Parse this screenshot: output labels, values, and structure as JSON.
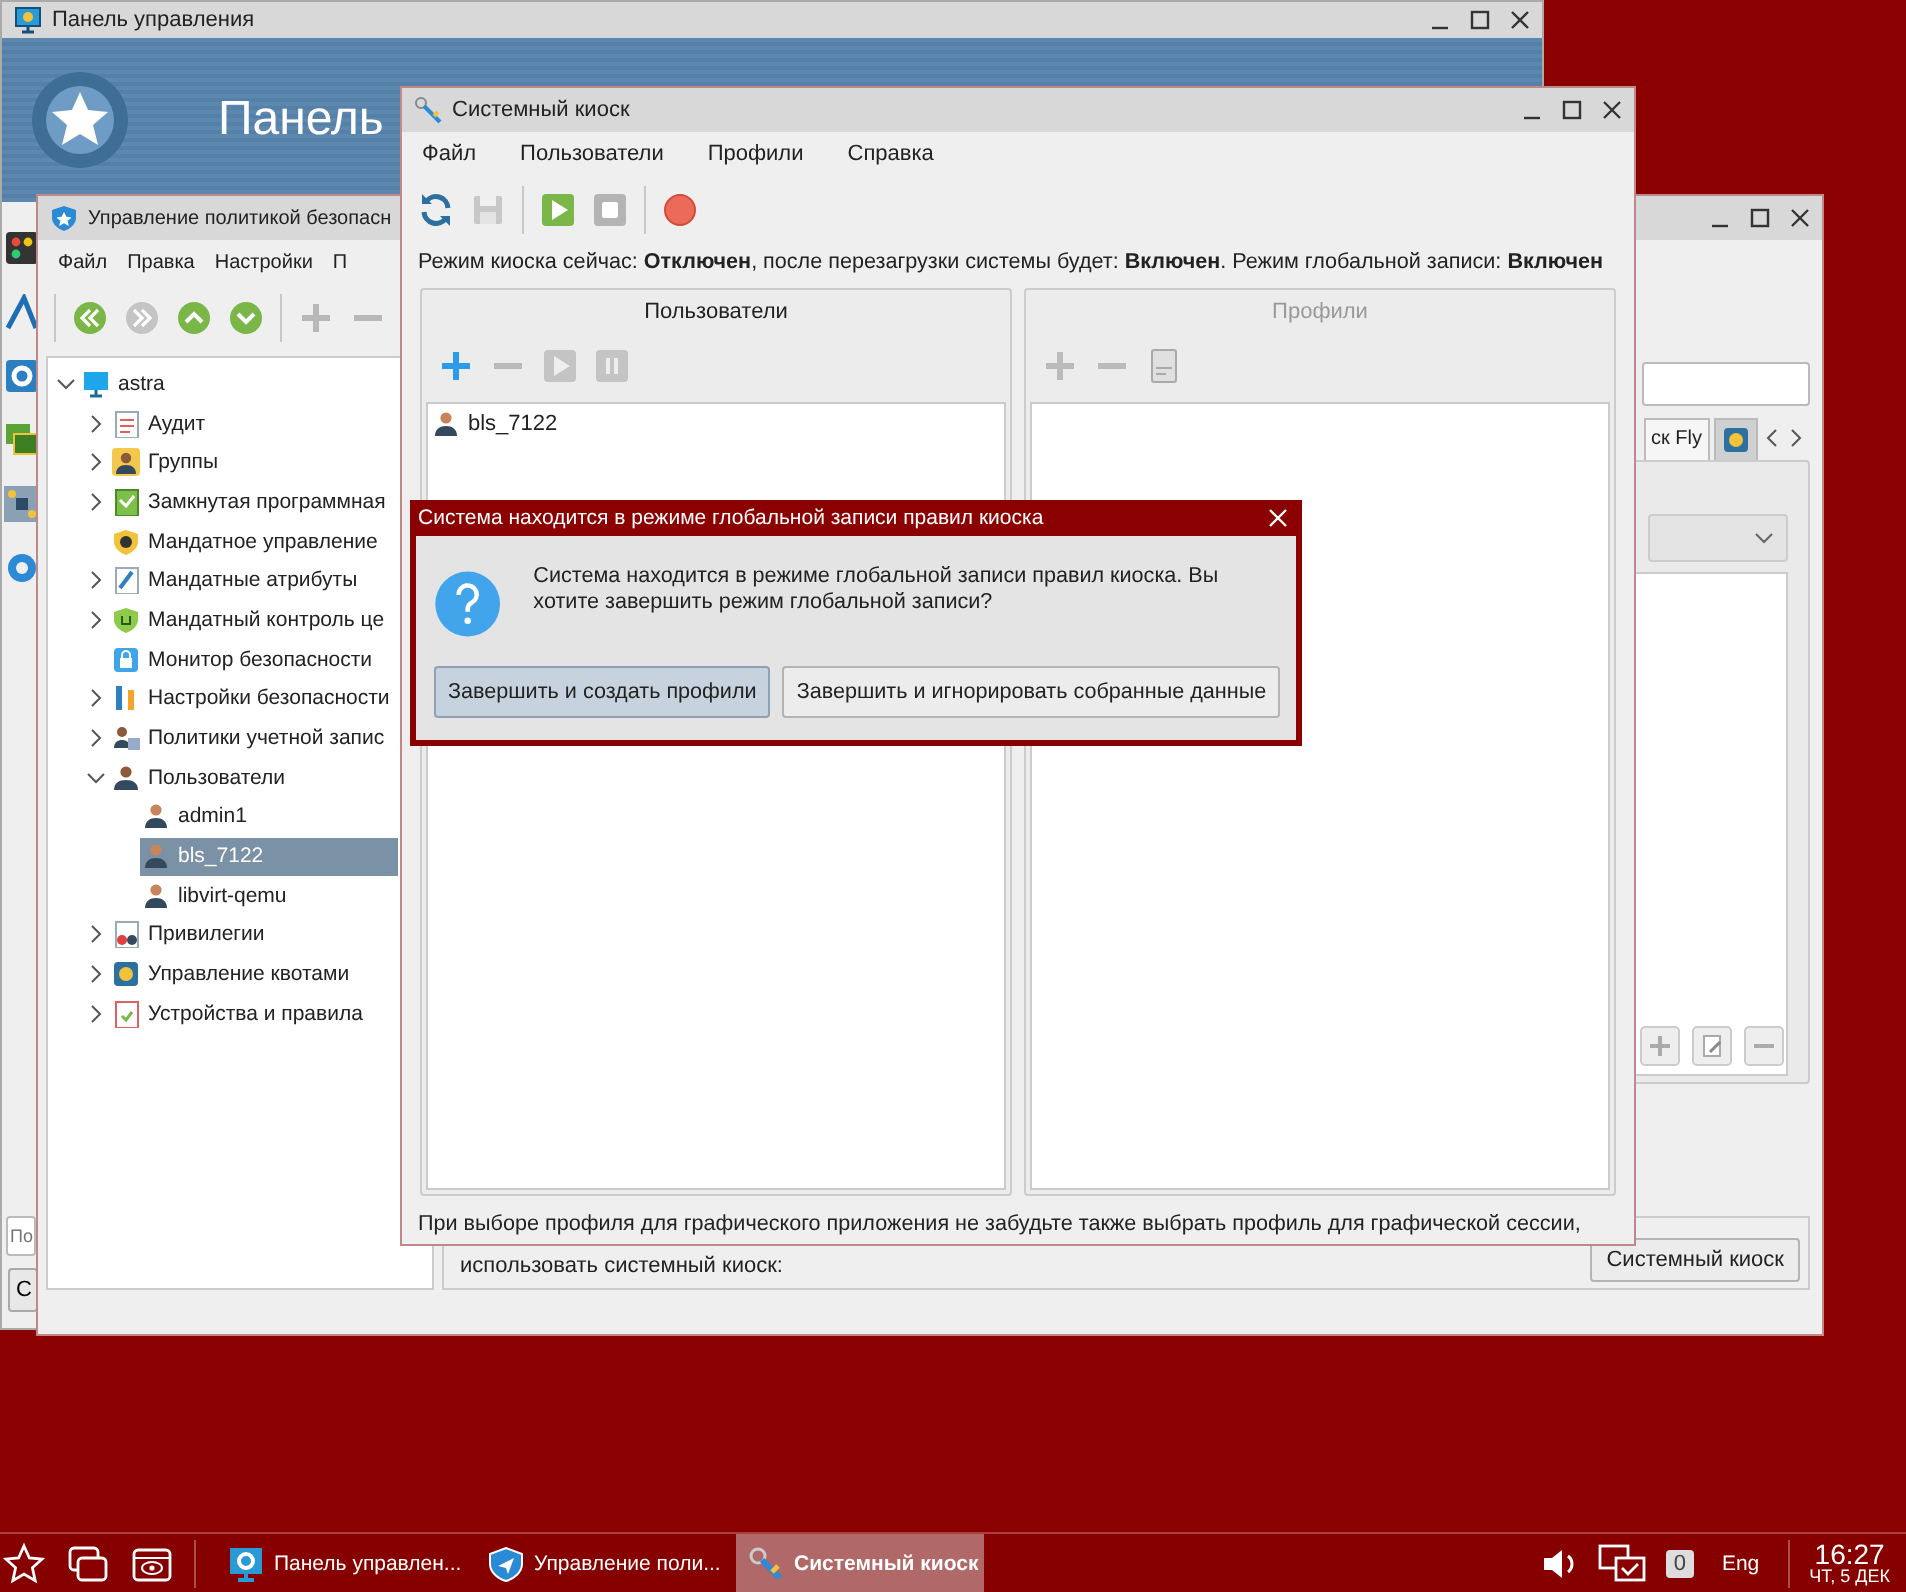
{
  "control_panel": {
    "title": "Панель управления",
    "banner_title": "Панель",
    "search": {
      "placeholder": "По"
    },
    "button": "С"
  },
  "policy_window": {
    "title": "Управление политикой безопасн",
    "menu": [
      "Файл",
      "Правка",
      "Настройки",
      "П"
    ],
    "toolbar": [
      {
        "disabled": false
      },
      {
        "disabled": true
      },
      {
        "disabled": false
      },
      {
        "disabled": false
      },
      {
        "disabled": true
      },
      {
        "disabled": true
      }
    ],
    "tree": [
      {
        "label": "astra",
        "expanded": true,
        "selected": false,
        "children": [
          {
            "label": "Аудит",
            "expanded": false,
            "selected": false
          },
          {
            "label": "Группы",
            "expanded": false,
            "selected": false
          },
          {
            "label": "Замкнутая программная",
            "expanded": false,
            "selected": false
          },
          {
            "label": "Мандатное управление",
            "selected": false
          },
          {
            "label": "Мандатные атрибуты",
            "expanded": false,
            "selected": false
          },
          {
            "label": "Мандатный контроль це",
            "expanded": false,
            "selected": false
          },
          {
            "label": "Монитор безопасности",
            "selected": false
          },
          {
            "label": "Настройки безопасности",
            "expanded": false,
            "selected": false
          },
          {
            "label": "Политики учетной запис",
            "expanded": false,
            "selected": false
          },
          {
            "label": "Пользователи",
            "expanded": true,
            "selected": false,
            "children": [
              {
                "label": "admin1",
                "selected": false
              },
              {
                "label": "bls_7122",
                "selected": true
              },
              {
                "label": "libvirt-qemu",
                "selected": false
              }
            ]
          },
          {
            "label": "Привилегии",
            "expanded": false,
            "selected": false
          },
          {
            "label": "Управление квотами",
            "expanded": false,
            "selected": false
          },
          {
            "label": "Устройства и правила",
            "expanded": false,
            "selected": false
          }
        ]
      }
    ],
    "tabs": [
      {
        "kind": "text",
        "label": "ск Fly",
        "selected": true
      },
      {
        "kind": "icon",
        "selected": false
      }
    ],
    "footer_text": "использовать системный киоск:",
    "footer_button": "Системный киоск"
  },
  "kiosk_window": {
    "title": "Системный киоск",
    "menu": [
      "Файл",
      "Пользователи",
      "Профили",
      "Справка"
    ],
    "toolbar": [
      {
        "disabled": false
      },
      {
        "disabled": true
      },
      {
        "disabled": false
      },
      {
        "disabled": true
      },
      {
        "disabled": false
      }
    ],
    "status": "Режим киоска сейчас: **Отключен**, после перезагрузки системы будет: **Включен**. Режим глобальной записи: **Включен**",
    "panels": [
      {
        "title": "Пользователи",
        "disabled": false,
        "toolbar": [
          {
            "disabled": false
          },
          {
            "disabled": true
          },
          {
            "disabled": true
          },
          {
            "disabled": true
          }
        ],
        "items": [
          "bls_7122"
        ]
      },
      {
        "title": "Профили",
        "disabled": true,
        "toolbar": [
          {
            "disabled": true
          },
          {
            "disabled": true
          },
          {
            "disabled": true
          }
        ]
      }
    ],
    "footer": "При выборе профиля для графического приложения не забудьте также выбрать профиль для графической сессии,"
  },
  "dialog": {
    "title": "Система находится в режиме глобальной записи правил киоска",
    "message": "Система находится в режиме глобальной записи правил киоска. Вы хотите завершить режим глобальной записи?",
    "buttons": [
      {
        "label": "Завершить и создать профили",
        "selected": true
      },
      {
        "label": "Завершить и игнорировать собранные данные",
        "selected": false
      }
    ]
  },
  "taskbar": {
    "tasks": [
      {
        "label": "Панель управлен...",
        "selected": false
      },
      {
        "label": "Управление поли...",
        "selected": false
      },
      {
        "label": "Системный киоск",
        "selected": true
      }
    ],
    "notifications": "0",
    "language": "Eng",
    "time": "16:27",
    "date": "ЧТ, 5 ДЕК"
  }
}
